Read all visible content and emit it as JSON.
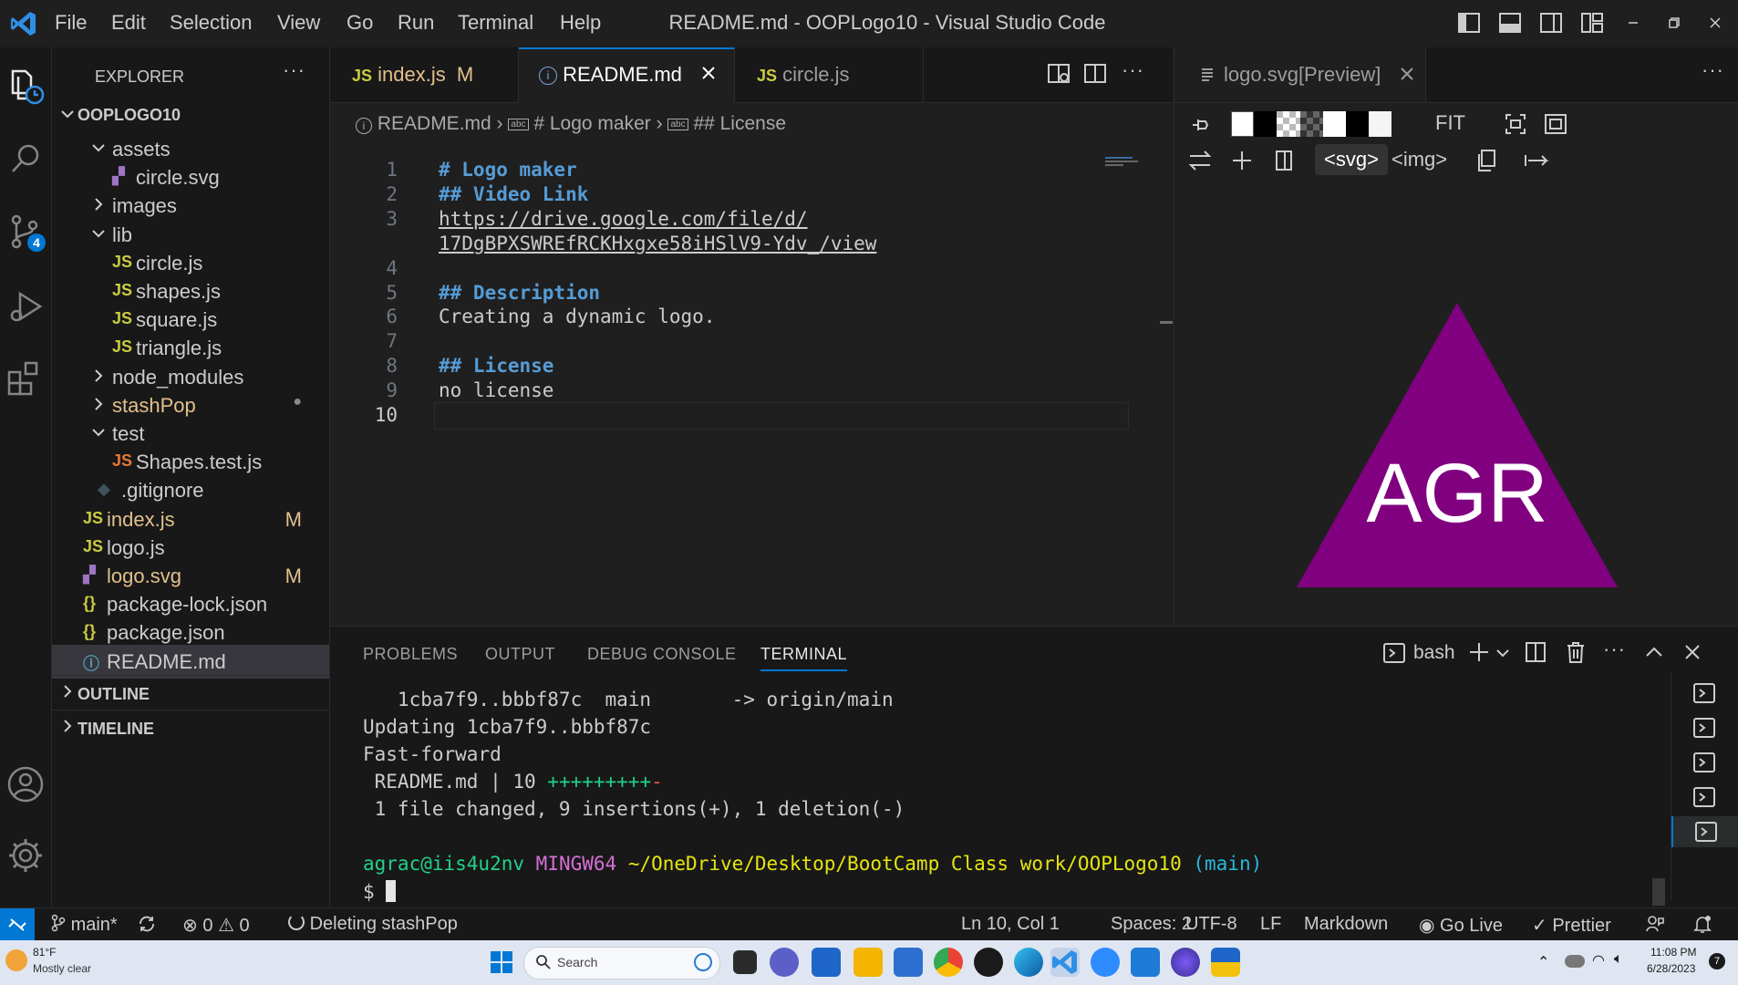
{
  "title_bar": {
    "menus": [
      "File",
      "Edit",
      "Selection",
      "View",
      "Go",
      "Run",
      "Terminal",
      "Help"
    ],
    "window_title": "README.md - OOPLogo10 - Visual Studio Code"
  },
  "activity_bar": {
    "source_control_badge": "4"
  },
  "explorer": {
    "header": "EXPLORER",
    "root": "OOPLOGO10",
    "items": [
      {
        "label": "assets",
        "kind": "folder-open",
        "depth": 1,
        "status": ""
      },
      {
        "label": "circle.svg",
        "kind": "svg",
        "depth": 2,
        "status": ""
      },
      {
        "label": "images",
        "kind": "folder",
        "depth": 1,
        "status": ""
      },
      {
        "label": "lib",
        "kind": "folder-open",
        "depth": 1,
        "status": ""
      },
      {
        "label": "circle.js",
        "kind": "js",
        "depth": 2,
        "status": ""
      },
      {
        "label": "shapes.js",
        "kind": "js",
        "depth": 2,
        "status": ""
      },
      {
        "label": "square.js",
        "kind": "js",
        "depth": 2,
        "status": ""
      },
      {
        "label": "triangle.js",
        "kind": "js",
        "depth": 2,
        "status": ""
      },
      {
        "label": "node_modules",
        "kind": "folder",
        "depth": 1,
        "status": ""
      },
      {
        "label": "stashPop",
        "kind": "folder",
        "depth": 1,
        "status": "●"
      },
      {
        "label": "test",
        "kind": "folder-open",
        "depth": 1,
        "status": ""
      },
      {
        "label": "Shapes.test.js",
        "kind": "test",
        "depth": 2,
        "status": ""
      },
      {
        "label": ".gitignore",
        "kind": "git",
        "depth": 1,
        "status": ""
      },
      {
        "label": "index.js",
        "kind": "js",
        "depth": 0,
        "status": "M"
      },
      {
        "label": "logo.js",
        "kind": "js",
        "depth": 0,
        "status": ""
      },
      {
        "label": "logo.svg",
        "kind": "svg",
        "depth": 0,
        "status": "M"
      },
      {
        "label": "package-lock.json",
        "kind": "json",
        "depth": 0,
        "status": ""
      },
      {
        "label": "package.json",
        "kind": "json",
        "depth": 0,
        "status": ""
      },
      {
        "label": "README.md",
        "kind": "info",
        "depth": 0,
        "status": ""
      }
    ],
    "outline": "OUTLINE",
    "timeline": "TIMELINE"
  },
  "editor": {
    "tabs": [
      {
        "label": "index.js",
        "badge": "M"
      },
      {
        "label": "README.md",
        "badge": ""
      },
      {
        "label": "circle.js",
        "badge": ""
      }
    ],
    "breadcrumb": [
      "README.md",
      "# Logo maker",
      "## License"
    ],
    "lines": [
      {
        "n": "1",
        "text": "# Logo maker"
      },
      {
        "n": "2",
        "text": "## Video Link"
      },
      {
        "n": "3",
        "text": "https://drive.google.com/file/d/"
      },
      {
        "n": "",
        "text": "17DgBPXSWREfRCKHxgxe58iHSlV9-Ydv_/view"
      },
      {
        "n": "4",
        "text": ""
      },
      {
        "n": "5",
        "text": "## Description"
      },
      {
        "n": "6",
        "text": "Creating a dynamic logo."
      },
      {
        "n": "7",
        "text": ""
      },
      {
        "n": "8",
        "text": "## License"
      },
      {
        "n": "9",
        "text": "no license"
      },
      {
        "n": "10",
        "text": ""
      }
    ]
  },
  "preview": {
    "tab_label": "logo.svg[Preview]",
    "fit_label": "FIT",
    "svg_label": "<svg>",
    "img_label": "<img>",
    "logo_text": "AGR",
    "logo_color": "#800080",
    "logo_text_color": "#ffffff"
  },
  "panel": {
    "tabs": [
      "PROBLEMS",
      "OUTPUT",
      "DEBUG CONSOLE",
      "TERMINAL"
    ],
    "active_tab": "TERMINAL",
    "shell": "bash",
    "terminal": {
      "line1": "   1cba7f9..bbbf87c  main       -> origin/main",
      "line2": "Updating 1cba7f9..bbbf87c",
      "line3": "Fast-forward",
      "line4_text": " README.md | 10 ",
      "line4_plus": "+++++++++",
      "line4_minus": "-",
      "line5": " 1 file changed, 9 insertions(+), 1 deletion(-)",
      "prompt_user": "agrac@iis4u2nv",
      "prompt_sys": "MINGW64",
      "prompt_path": "~/OneDrive/Desktop/BootCamp Class work/OOPLogo10",
      "prompt_branch": "(main)",
      "prompt_symbol": "$"
    }
  },
  "status_bar": {
    "branch": "main*",
    "errors": "0",
    "warnings": "0",
    "task": "Deleting stashPop",
    "position": "Ln 10, Col 1",
    "spaces": "Spaces: 2",
    "encoding": "UTF-8",
    "eol": "LF",
    "language": "Markdown",
    "golive": "Go Live",
    "prettier": "Prettier"
  },
  "taskbar": {
    "weather_temp": "81°F",
    "weather_desc": "Mostly clear",
    "search": "Search",
    "time": "11:08 PM",
    "date": "6/28/2023",
    "notifications": "7"
  }
}
